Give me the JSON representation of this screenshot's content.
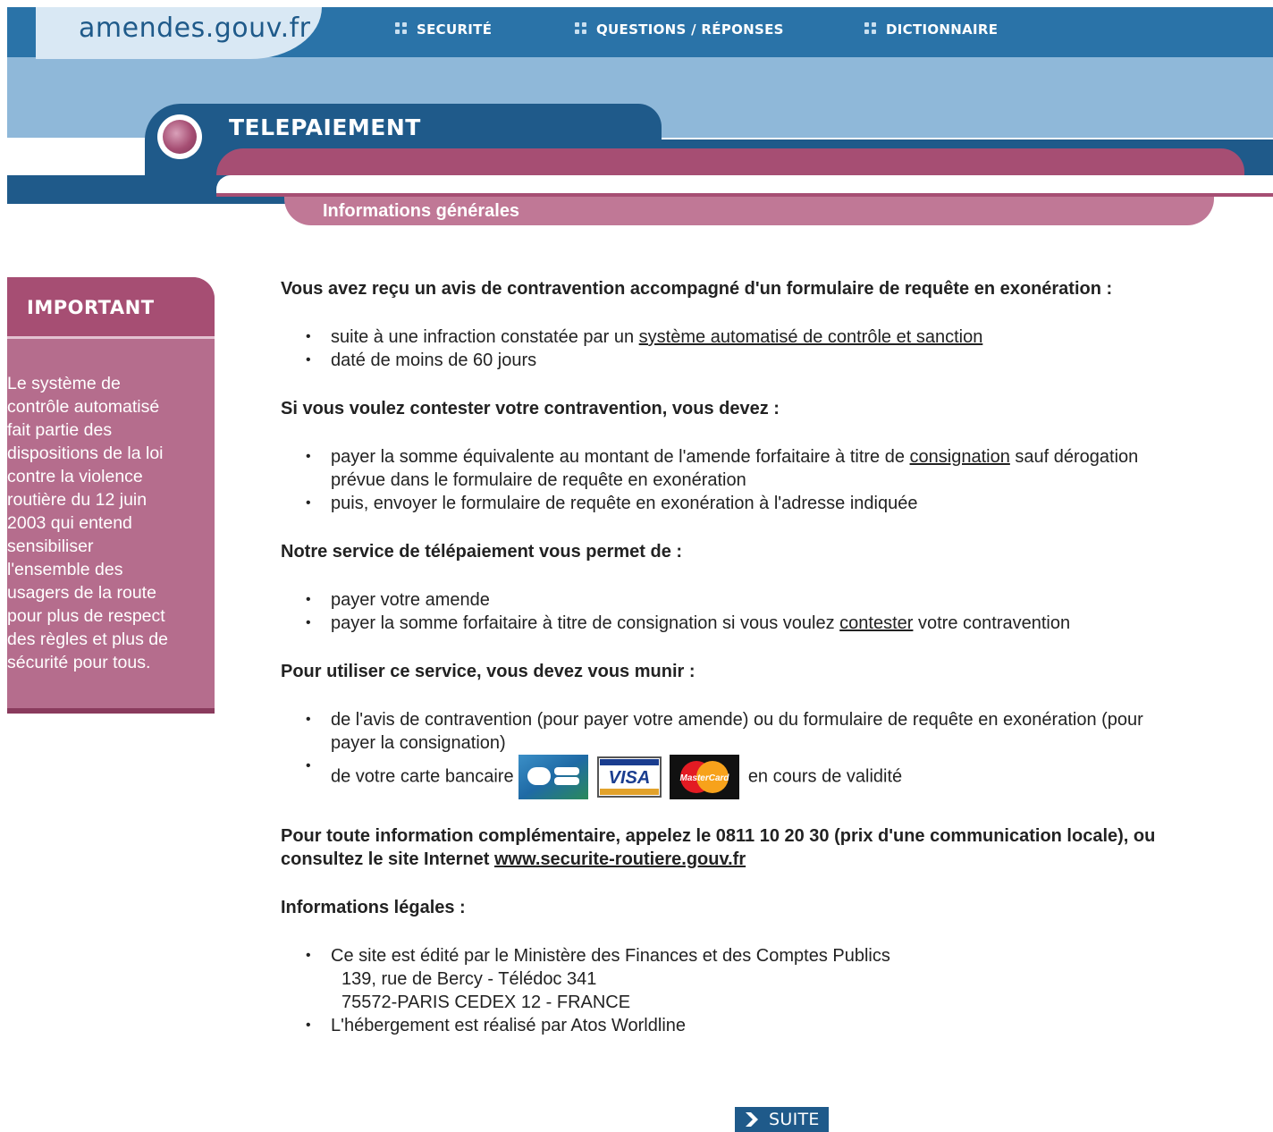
{
  "header": {
    "logo_text": "amendes.gouv.fr",
    "nav": [
      {
        "label": "SECURITÉ"
      },
      {
        "label": "QUESTIONS / RÉPONSES"
      },
      {
        "label": "DICTIONNAIRE"
      }
    ],
    "section_title": "TELEPAIEMENT",
    "subsection_title": "Informations générales"
  },
  "sidebar": {
    "title": "IMPORTANT",
    "text_lines": [
      "Le système de",
      "contrôle automatisé",
      "fait partie des",
      "dispositions de la loi",
      "contre la violence",
      "routière du 12 juin",
      "2003 qui entend",
      "sensibiliser",
      "l'ensemble des",
      "usagers de la route",
      "pour plus de respect",
      "des règles et plus de",
      "sécurité pour tous."
    ]
  },
  "content": {
    "s1": {
      "heading": "Vous avez reçu un avis de contravention accompagné d'un formulaire de requête en exonération :",
      "b1_text": "suite à une infraction constatée par un ",
      "b1_link": "système automatisé de contrôle et sanction",
      "b2_text": "daté de moins de 60 jours"
    },
    "s2": {
      "heading": "Si vous voulez contester votre contravention, vous devez :",
      "b1_text_a": "payer la somme équivalente au montant de l'amende forfaitaire à titre de ",
      "b1_link": "consignation",
      "b1_text_b": " sauf dérogation",
      "b1_line2": "prévue dans le formulaire de requête en exonération",
      "b2_text": "puis, envoyer le formulaire de requête en exonération à l'adresse indiquée"
    },
    "s3": {
      "heading": "Notre service de télépaiement vous permet de :",
      "b1_text": "payer votre amende",
      "b2_text_a": "payer la somme forfaitaire à titre de consignation si vous voulez ",
      "b2_link": "contester",
      "b2_text_b": " votre contravention"
    },
    "s4": {
      "heading": "Pour utiliser ce service, vous devez vous munir :",
      "b1_line1": "de l'avis de contravention (pour payer votre amende) ou du formulaire de requête en exonération (pour",
      "b1_line2": "payer la consignation)",
      "b2_text_a": "de votre carte bancaire",
      "b2_text_b": "en cours de validité",
      "cards": [
        "CB",
        "VISA",
        "MasterCard"
      ]
    },
    "s5": {
      "line1": "Pour toute information complémentaire, appelez le 0811 10 20 30 (prix d'une communication locale), ou",
      "line2_text": "consultez le site Internet ",
      "line2_link": "www.securite-routiere.gouv.fr"
    },
    "s6": {
      "heading": "Informations légales :",
      "b1_line1": "Ce site est édité par le Ministère des Finances et des Comptes Publics",
      "b1_line2": "139, rue de Bercy - Télédoc 341",
      "b1_line3": "75572-PARIS CEDEX 12 - FRANCE",
      "b2_text": "L'hébergement est réalisé par Atos Worldline"
    }
  },
  "footer": {
    "suite_label": "SUITE"
  },
  "colors": {
    "nav_blue": "#2a73a8",
    "dark_blue": "#1f5a8a",
    "light_blue": "#8fb8d9",
    "magenta": "#a64e73",
    "pink": "#b56d8d"
  }
}
